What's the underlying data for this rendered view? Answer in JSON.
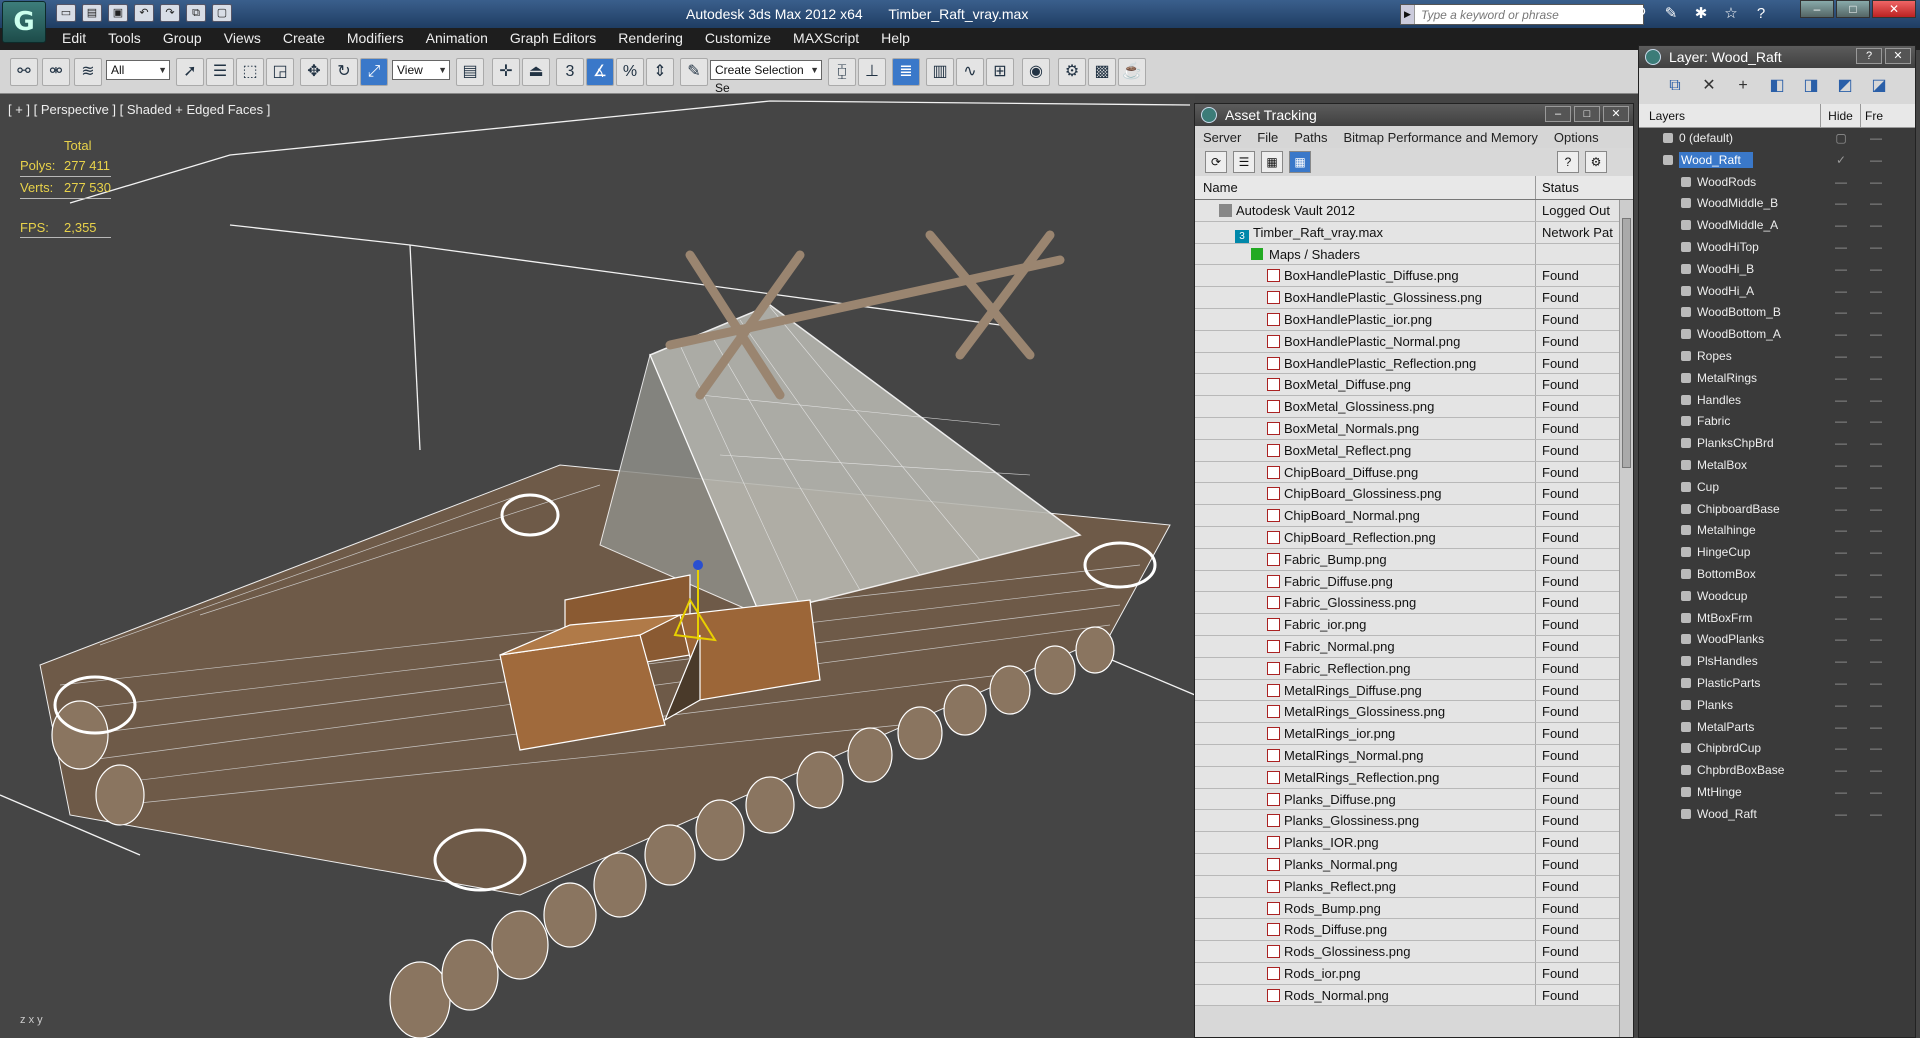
{
  "app": {
    "title": "Autodesk 3ds Max  2012 x64",
    "file": "Timber_Raft_vray.max",
    "search_placeholder": "Type a keyword or phrase",
    "logo_letter": "G"
  },
  "menu": [
    "Edit",
    "Tools",
    "Group",
    "Views",
    "Create",
    "Modifiers",
    "Animation",
    "Graph Editors",
    "Rendering",
    "Customize",
    "MAXScript",
    "Help"
  ],
  "toolbar": {
    "filter_select": "All",
    "coord_select": "View",
    "snap_number": "3",
    "selection_set_placeholder": "Create Selection Se"
  },
  "viewport": {
    "label": "[ + ] [ Perspective ] [ Shaded + Edged Faces ]",
    "stats_total_label": "Total",
    "polys_label": "Polys:",
    "polys_value": "277 411",
    "verts_label": "Verts:",
    "verts_value": "277 530",
    "fps_label": "FPS:",
    "fps_value": "2,355",
    "axis_z": "z",
    "axis_x": "x",
    "axis_y": "y"
  },
  "asset_tracking": {
    "title": "Asset Tracking",
    "menu": [
      "Server",
      "File",
      "Paths",
      "Bitmap Performance and Memory",
      "Options"
    ],
    "col_name": "Name",
    "col_status": "Status",
    "rows": [
      {
        "name": "Autodesk Vault 2012",
        "status": "Logged Out",
        "type": "vault",
        "indent": 0
      },
      {
        "name": "Timber_Raft_vray.max",
        "status": "Network Pat",
        "type": "max",
        "indent": 1
      },
      {
        "name": "Maps / Shaders",
        "status": "",
        "type": "group",
        "indent": 2
      },
      {
        "name": "BoxHandlePlastic_Diffuse.png",
        "status": "Found",
        "type": "file",
        "indent": 3
      },
      {
        "name": "BoxHandlePlastic_Glossiness.png",
        "status": "Found",
        "type": "file",
        "indent": 3
      },
      {
        "name": "BoxHandlePlastic_ior.png",
        "status": "Found",
        "type": "file",
        "indent": 3
      },
      {
        "name": "BoxHandlePlastic_Normal.png",
        "status": "Found",
        "type": "file",
        "indent": 3
      },
      {
        "name": "BoxHandlePlastic_Reflection.png",
        "status": "Found",
        "type": "file",
        "indent": 3
      },
      {
        "name": "BoxMetal_Diffuse.png",
        "status": "Found",
        "type": "file",
        "indent": 3
      },
      {
        "name": "BoxMetal_Glossiness.png",
        "status": "Found",
        "type": "file",
        "indent": 3
      },
      {
        "name": "BoxMetal_Normals.png",
        "status": "Found",
        "type": "file",
        "indent": 3
      },
      {
        "name": "BoxMetal_Reflect.png",
        "status": "Found",
        "type": "file",
        "indent": 3
      },
      {
        "name": "ChipBoard_Diffuse.png",
        "status": "Found",
        "type": "file",
        "indent": 3
      },
      {
        "name": "ChipBoard_Glossiness.png",
        "status": "Found",
        "type": "file",
        "indent": 3
      },
      {
        "name": "ChipBoard_Normal.png",
        "status": "Found",
        "type": "file",
        "indent": 3
      },
      {
        "name": "ChipBoard_Reflection.png",
        "status": "Found",
        "type": "file",
        "indent": 3
      },
      {
        "name": "Fabric_Bump.png",
        "status": "Found",
        "type": "file",
        "indent": 3
      },
      {
        "name": "Fabric_Diffuse.png",
        "status": "Found",
        "type": "file",
        "indent": 3
      },
      {
        "name": "Fabric_Glossiness.png",
        "status": "Found",
        "type": "file",
        "indent": 3
      },
      {
        "name": "Fabric_ior.png",
        "status": "Found",
        "type": "file",
        "indent": 3
      },
      {
        "name": "Fabric_Normal.png",
        "status": "Found",
        "type": "file",
        "indent": 3
      },
      {
        "name": "Fabric_Reflection.png",
        "status": "Found",
        "type": "file",
        "indent": 3
      },
      {
        "name": "MetalRings_Diffuse.png",
        "status": "Found",
        "type": "file",
        "indent": 3
      },
      {
        "name": "MetalRings_Glossiness.png",
        "status": "Found",
        "type": "file",
        "indent": 3
      },
      {
        "name": "MetalRings_ior.png",
        "status": "Found",
        "type": "file",
        "indent": 3
      },
      {
        "name": "MetalRings_Normal.png",
        "status": "Found",
        "type": "file",
        "indent": 3
      },
      {
        "name": "MetalRings_Reflection.png",
        "status": "Found",
        "type": "file",
        "indent": 3
      },
      {
        "name": "Planks_Diffuse.png",
        "status": "Found",
        "type": "file",
        "indent": 3
      },
      {
        "name": "Planks_Glossiness.png",
        "status": "Found",
        "type": "file",
        "indent": 3
      },
      {
        "name": "Planks_IOR.png",
        "status": "Found",
        "type": "file",
        "indent": 3
      },
      {
        "name": "Planks_Normal.png",
        "status": "Found",
        "type": "file",
        "indent": 3
      },
      {
        "name": "Planks_Reflect.png",
        "status": "Found",
        "type": "file",
        "indent": 3
      },
      {
        "name": "Rods_Bump.png",
        "status": "Found",
        "type": "file",
        "indent": 3
      },
      {
        "name": "Rods_Diffuse.png",
        "status": "Found",
        "type": "file",
        "indent": 3
      },
      {
        "name": "Rods_Glossiness.png",
        "status": "Found",
        "type": "file",
        "indent": 3
      },
      {
        "name": "Rods_ior.png",
        "status": "Found",
        "type": "file",
        "indent": 3
      },
      {
        "name": "Rods_Normal.png",
        "status": "Found",
        "type": "file",
        "indent": 3
      }
    ]
  },
  "layers": {
    "title": "Layer: Wood_Raft",
    "col_layers": "Layers",
    "col_hide": "Hide",
    "col_freeze": "Fre",
    "items": [
      {
        "name": "0 (default)",
        "selected": false,
        "child": false
      },
      {
        "name": "Wood_Raft",
        "selected": true,
        "child": false
      },
      {
        "name": "WoodRods",
        "selected": false,
        "child": true
      },
      {
        "name": "WoodMiddle_B",
        "selected": false,
        "child": true
      },
      {
        "name": "WoodMiddle_A",
        "selected": false,
        "child": true
      },
      {
        "name": "WoodHiTop",
        "selected": false,
        "child": true
      },
      {
        "name": "WoodHi_B",
        "selected": false,
        "child": true
      },
      {
        "name": "WoodHi_A",
        "selected": false,
        "child": true
      },
      {
        "name": "WoodBottom_B",
        "selected": false,
        "child": true
      },
      {
        "name": "WoodBottom_A",
        "selected": false,
        "child": true
      },
      {
        "name": "Ropes",
        "selected": false,
        "child": true
      },
      {
        "name": "MetalRings",
        "selected": false,
        "child": true
      },
      {
        "name": "Handles",
        "selected": false,
        "child": true
      },
      {
        "name": "Fabric",
        "selected": false,
        "child": true
      },
      {
        "name": "PlanksChpBrd",
        "selected": false,
        "child": true
      },
      {
        "name": "MetalBox",
        "selected": false,
        "child": true
      },
      {
        "name": "Cup",
        "selected": false,
        "child": true
      },
      {
        "name": "ChipboardBase",
        "selected": false,
        "child": true
      },
      {
        "name": "Metalhinge",
        "selected": false,
        "child": true
      },
      {
        "name": "HingeCup",
        "selected": false,
        "child": true
      },
      {
        "name": "BottomBox",
        "selected": false,
        "child": true
      },
      {
        "name": "Woodcup",
        "selected": false,
        "child": true
      },
      {
        "name": "MtBoxFrm",
        "selected": false,
        "child": true
      },
      {
        "name": "WoodPlanks",
        "selected": false,
        "child": true
      },
      {
        "name": "PlsHandles",
        "selected": false,
        "child": true
      },
      {
        "name": "PlasticParts",
        "selected": false,
        "child": true
      },
      {
        "name": "Planks",
        "selected": false,
        "child": true
      },
      {
        "name": "MetalParts",
        "selected": false,
        "child": true
      },
      {
        "name": "ChipbrdCup",
        "selected": false,
        "child": true
      },
      {
        "name": "ChpbrdBoxBase",
        "selected": false,
        "child": true
      },
      {
        "name": "MtHinge",
        "selected": false,
        "child": true
      },
      {
        "name": "Wood_Raft",
        "selected": false,
        "child": true
      }
    ]
  },
  "colors": {
    "stats": "#e8d24a",
    "selection": "#3a78c9",
    "viewport_bg": "#454545"
  }
}
